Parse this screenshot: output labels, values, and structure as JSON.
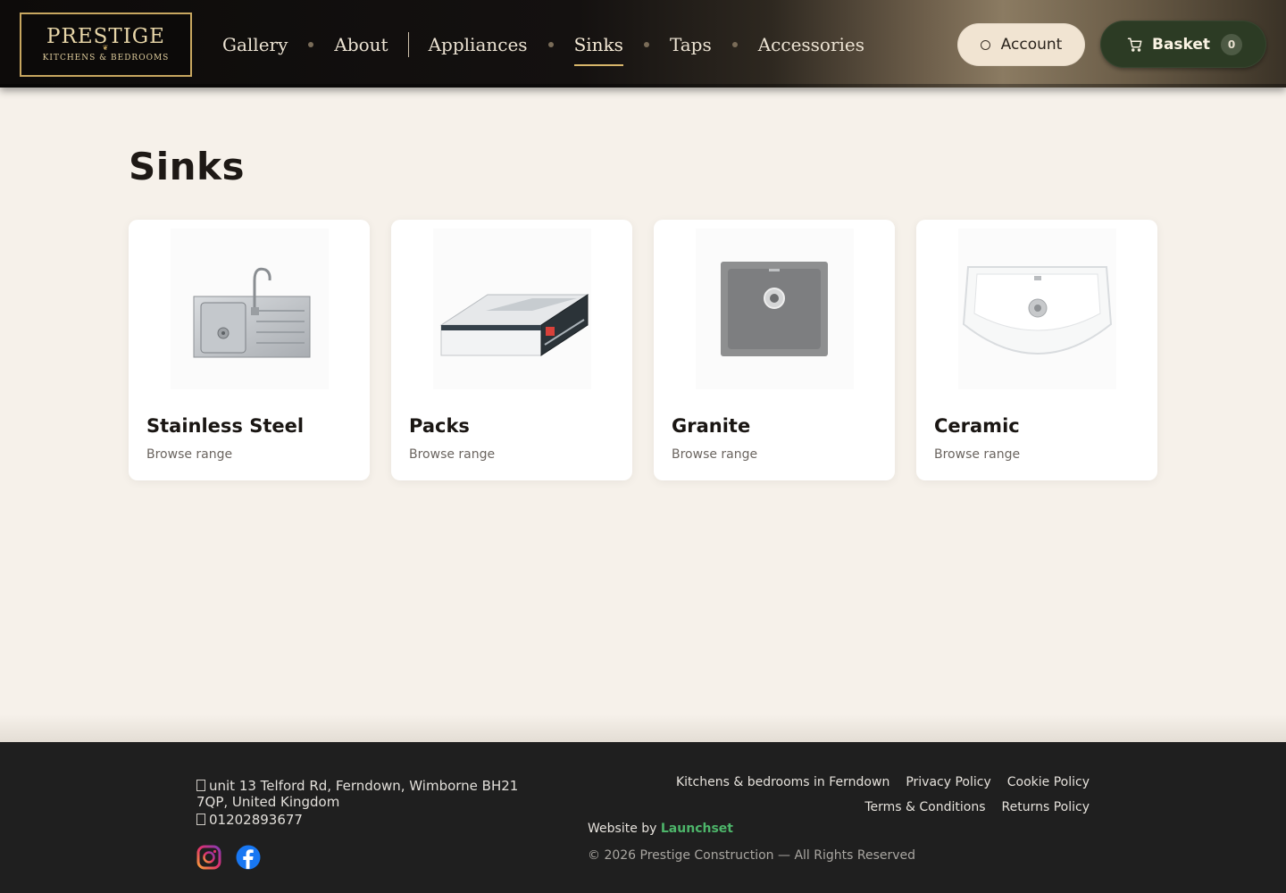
{
  "header": {
    "logo": {
      "main": "PRESTIGE",
      "sub": "KITCHENS & BEDROOMS"
    },
    "nav": [
      {
        "label": "Gallery",
        "active": false
      },
      {
        "label": "About",
        "active": false
      },
      {
        "label": "Appliances",
        "active": false
      },
      {
        "label": "Sinks",
        "active": true
      },
      {
        "label": "Taps",
        "active": false
      },
      {
        "label": "Accessories",
        "active": false
      }
    ],
    "account_label": "Account",
    "basket_label": "Basket",
    "basket_count": "0"
  },
  "main": {
    "title": "Sinks",
    "categories": [
      {
        "title": "Stainless Steel",
        "link": "Browse range",
        "icon": "stainless-steel-sink-image"
      },
      {
        "title": "Packs",
        "link": "Browse range",
        "icon": "sink-pack-box-image"
      },
      {
        "title": "Granite",
        "link": "Browse range",
        "icon": "granite-sink-image"
      },
      {
        "title": "Ceramic",
        "link": "Browse range",
        "icon": "ceramic-sink-image"
      }
    ]
  },
  "footer": {
    "address": "unit 13 Telford Rd, Ferndown, Wimborne BH21 7QP, United Kingdom",
    "phone": "01202893677",
    "links_row1": [
      "Kitchens & bedrooms in Ferndown",
      "Privacy Policy",
      "Cookie Policy"
    ],
    "links_row2": [
      "Terms & Conditions",
      "Returns Policy"
    ],
    "credit_prefix": "Website by",
    "credit_name": "Launchset",
    "copyright": "© 2026 Prestige Construction — All Rights Reserved"
  },
  "colors": {
    "accent_gold": "#d8b66a",
    "basket_green": "#2c3b24",
    "credit_green": "#4db56a",
    "page_bg": "#f6f1ea",
    "footer_bg": "#1f1f1f"
  }
}
